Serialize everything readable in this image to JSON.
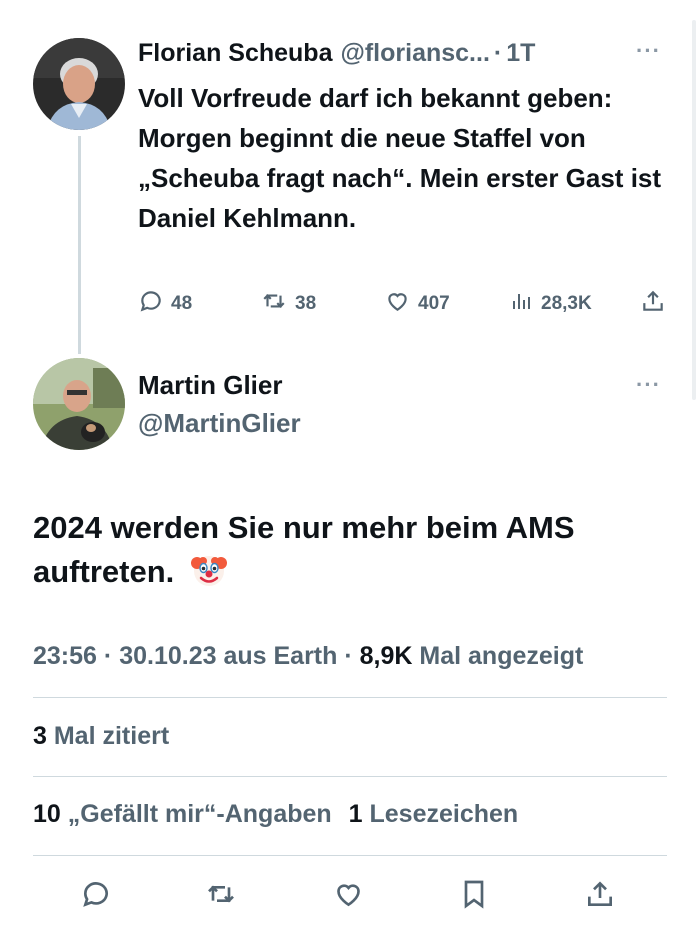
{
  "tweet1": {
    "author_name": "Florian Scheuba",
    "author_handle": "@floriansc...",
    "separator": "·",
    "time": "1T",
    "more": "···",
    "text": "Voll Vorfreude darf ich bekannt geben: Morgen beginnt die neue Staffel von „Scheuba fragt nach“. Mein erster Gast ist Daniel Kehlmann.",
    "replies": "48",
    "retweets": "38",
    "likes": "407",
    "views": "28,3K"
  },
  "tweet2": {
    "author_name": "Martin Glier",
    "author_handle": "@MartinGlier",
    "more": "···",
    "text": "2024 werden Sie nur mehr beim AMS auftreten.",
    "emoji": "clown-face",
    "meta_time": "23:56",
    "meta_date": "30.10.23",
    "meta_source": "aus Earth",
    "meta_views_count": "8,9K",
    "meta_views_label": "Mal angezeigt",
    "quotes_count": "3",
    "quotes_label": "Mal zitiert",
    "likes_count": "10",
    "likes_label": "„Gefällt mir“-Angaben",
    "bookmarks_count": "1",
    "bookmarks_label": "Lesezeichen"
  },
  "icons": [
    "reply-icon",
    "retweet-icon",
    "like-icon",
    "views-icon",
    "share-icon",
    "bookmark-icon",
    "clown-emoji-icon"
  ],
  "colors": {
    "text": "#0f1419",
    "secondary": "#536471",
    "divider": "#cfd9de"
  }
}
